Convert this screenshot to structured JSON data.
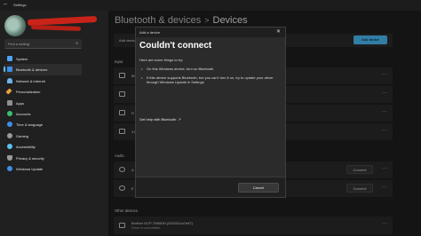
{
  "window": {
    "title": "Settings",
    "back_glyph": "←"
  },
  "search": {
    "placeholder": "Find a setting",
    "icon": "search-icon"
  },
  "sidebar": {
    "items": [
      {
        "label": "System",
        "icon": "monitor-icon",
        "color": "#4fa3f7"
      },
      {
        "label": "Bluetooth & devices",
        "icon": "bluetooth-icon",
        "color": "#3b8fe8",
        "active": true
      },
      {
        "label": "Network & internet",
        "icon": "wifi-icon",
        "color": "#6fb1e8"
      },
      {
        "label": "Personalization",
        "icon": "brush-icon",
        "color": "#e8a23b"
      },
      {
        "label": "Apps",
        "icon": "apps-icon",
        "color": "#8f8f8f"
      },
      {
        "label": "Accounts",
        "icon": "person-icon",
        "color": "#3bbf6f"
      },
      {
        "label": "Time & language",
        "icon": "globe-clock-icon",
        "color": "#3b8fe8"
      },
      {
        "label": "Gaming",
        "icon": "gamepad-icon",
        "color": "#9a9a9a"
      },
      {
        "label": "Accessibility",
        "icon": "accessibility-icon",
        "color": "#5dc0f2"
      },
      {
        "label": "Privacy & security",
        "icon": "shield-icon",
        "color": "#9a9a9a"
      },
      {
        "label": "Windows Update",
        "icon": "update-icon",
        "color": "#3b8fe8"
      }
    ]
  },
  "header": {
    "crumb_parent": "Bluetooth & devices",
    "separator": ">",
    "crumb_current": "Devices"
  },
  "add_device": {
    "label": "Add device",
    "button": "Add device"
  },
  "sections": {
    "input": "Input",
    "audio": "Audio",
    "other": "Other devices"
  },
  "input_rows": [
    {
      "title": "Bl",
      "more": "···"
    },
    {
      "title": "",
      "more": "···"
    },
    {
      "title": "R",
      "more": "···"
    },
    {
      "title": "XI",
      "more": "···"
    }
  ],
  "audio_rows": [
    {
      "title": "A",
      "button": "Connect",
      "more": "···"
    },
    {
      "title": "E",
      "button": "Connect",
      "more": "···"
    }
  ],
  "other_rows": [
    {
      "title": "Brother DCP-7065DN (30023c1a7e87)",
      "subtitle": "Driver is unavailable",
      "more": "···"
    }
  ],
  "dialog": {
    "window_title": "Add a device",
    "close_glyph": "✕",
    "heading": "Couldn't connect",
    "intro": "Here are some things to try:",
    "bullets": [
      "On this Windows device, turn on Bluetooth",
      "If this device supports Bluetooth, but you can't turn it on, try to update your driver through Windows Update in Settings"
    ],
    "link": "Get help with Bluetooth",
    "link_icon": "external-link-icon",
    "cancel": "Cancel"
  }
}
